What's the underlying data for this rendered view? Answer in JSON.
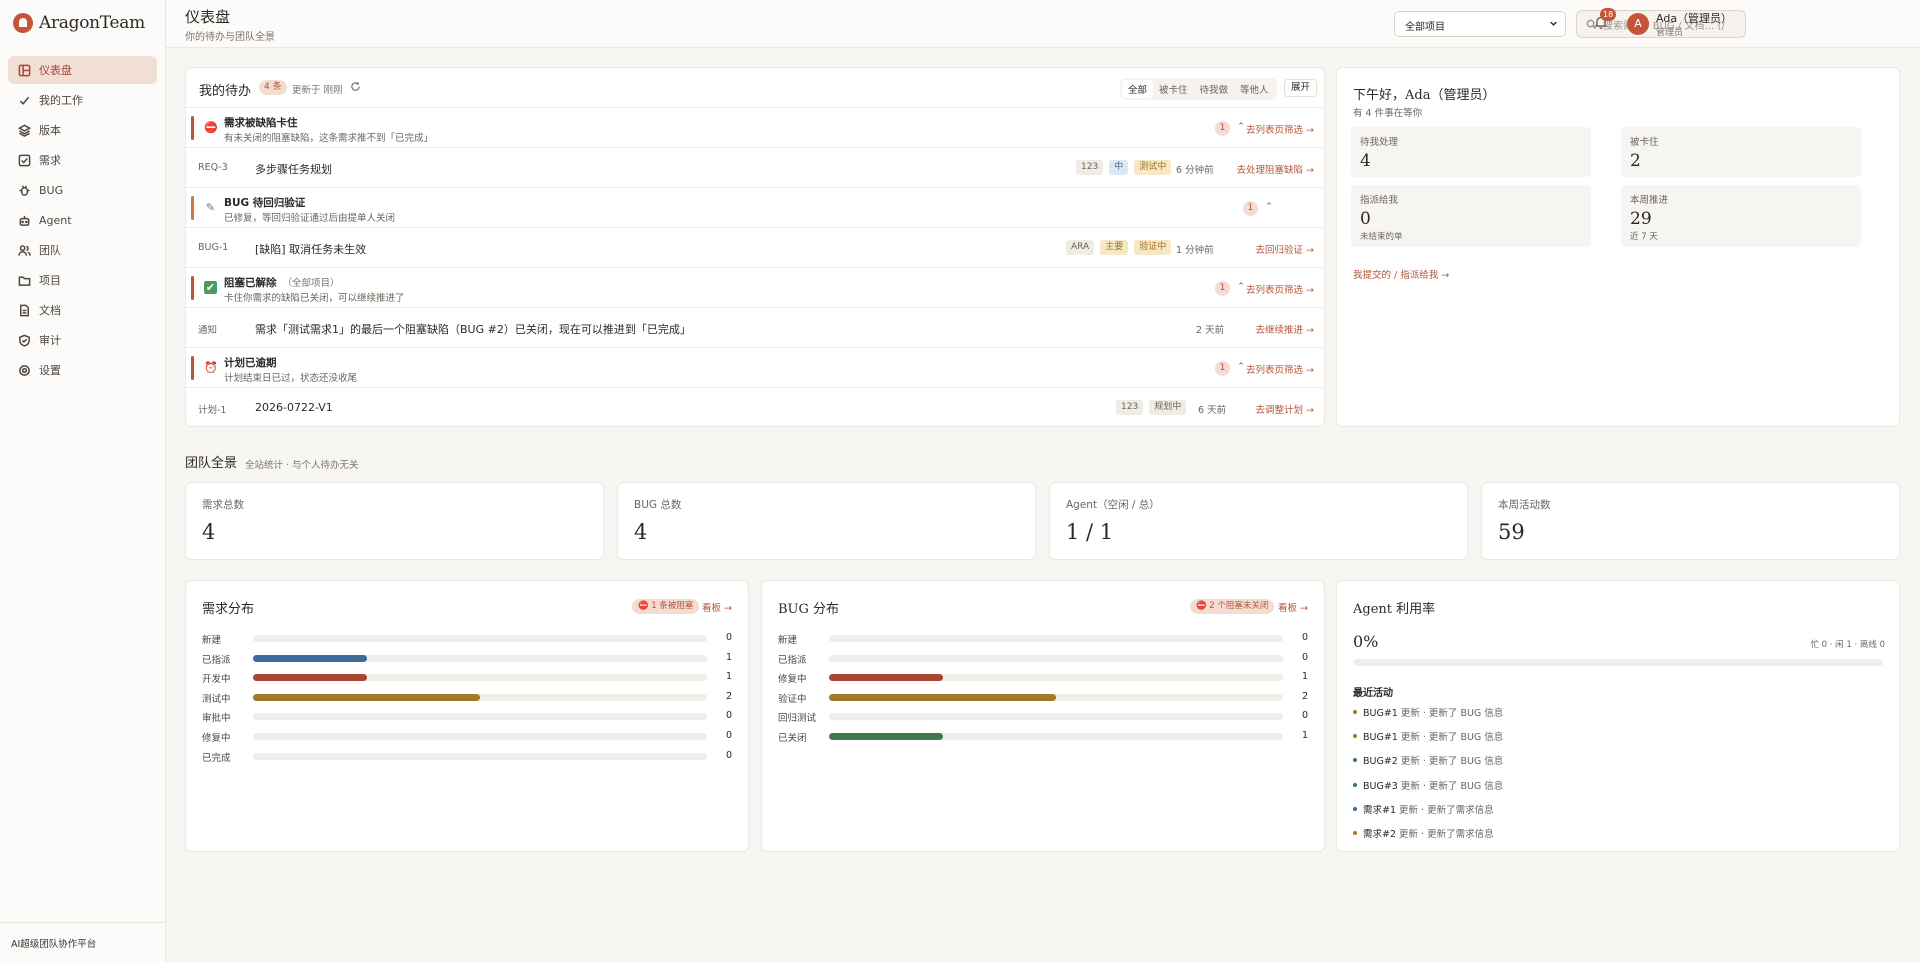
{
  "app": {
    "name": "AragonTeam",
    "footer": "AI超级团队协作平台"
  },
  "sidebar": {
    "items": [
      {
        "label": "仪表盘",
        "icon": "dashboard-icon",
        "active": true
      },
      {
        "label": "我的工作",
        "icon": "check-icon"
      },
      {
        "label": "版本",
        "icon": "layers-icon"
      },
      {
        "label": "需求",
        "icon": "checkbox-icon"
      },
      {
        "label": "BUG",
        "icon": "bug-icon"
      },
      {
        "label": "Agent",
        "icon": "robot-icon"
      },
      {
        "label": "团队",
        "icon": "users-icon"
      },
      {
        "label": "项目",
        "icon": "folder-icon"
      },
      {
        "label": "文档",
        "icon": "file-icon"
      },
      {
        "label": "审计",
        "icon": "shield-icon"
      },
      {
        "label": "设置",
        "icon": "gear-icon"
      }
    ]
  },
  "header": {
    "title": "仪表盘",
    "subtitle": "你的待办与团队全景",
    "project_select": "全部项目",
    "search_placeholder": "搜索需求 / BUG / 文档…  (/",
    "notifications": "18",
    "avatar_letter": "A",
    "user_name": "Ada（管理员）",
    "user_role": "管理员"
  },
  "todo": {
    "title": "我的待办",
    "count": "4 条",
    "updated": "更新于 刚刚",
    "filters": [
      "全部",
      "被卡住",
      "待我做",
      "等他人"
    ],
    "expand": "展开",
    "groups": [
      {
        "title": "需求被缺陷卡住",
        "scope": "",
        "sub": "有未关闭的阻塞缺陷，这条需求推不到「已完成」",
        "count": "1",
        "link": "去列表页筛选 →",
        "color": "#b5553a",
        "row": {
          "id": "REQ-3",
          "title": "多步骤任务规划",
          "tags": [
            "123",
            "中",
            "测试中"
          ],
          "time": "6 分钟前",
          "link": "去处理阻塞缺陷 →"
        }
      },
      {
        "title": "BUG 待回归验证",
        "scope": "",
        "sub": "已修复，等回归验证通过后由提单人关闭",
        "count": "1",
        "link": "",
        "color": "#c67a4a",
        "row": {
          "id": "BUG-1",
          "title": "[缺陷] 取消任务未生效",
          "tags": [
            "ARA",
            "主要",
            "验证中"
          ],
          "time": "1 分钟前",
          "link": "去回归验证 →"
        }
      },
      {
        "title": "阻塞已解除",
        "scope": "（全部项目）",
        "sub": "卡住你需求的缺陷已关闭，可以继续推进了",
        "count": "1",
        "link": "去列表页筛选 →",
        "color": "#b5553a",
        "row": {
          "id": "通知",
          "title": "需求「测试需求1」的最后一个阻塞缺陷（BUG #2）已关闭，现在可以推进到「已完成」",
          "tags": [],
          "time": "2 天前",
          "link": "去继续推进 →"
        }
      },
      {
        "title": "计划已逾期",
        "scope": "",
        "sub": "计划结束日已过，状态还没收尾",
        "count": "1",
        "link": "去列表页筛选 →",
        "color": "#b5553a",
        "row": {
          "id": "计划-1",
          "title": "2026-0722-V1",
          "tags": [
            "123",
            "规划中"
          ],
          "time": "6 天前",
          "link": "去调整计划 →"
        }
      }
    ]
  },
  "greeting": {
    "title": "下午好，Ada（管理员）",
    "sub": "有 4 件事在等你",
    "stats": [
      {
        "label": "待我处理",
        "value": "4",
        "sub": ""
      },
      {
        "label": "被卡住",
        "value": "2",
        "sub": ""
      },
      {
        "label": "指派给我",
        "value": "0",
        "sub": "未结束的单"
      },
      {
        "label": "本周推进",
        "value": "29",
        "sub": "近 7 天"
      }
    ],
    "link": "我提交的 / 指派给我 →"
  },
  "team": {
    "title": "团队全景",
    "sub": "全站统计 · 与个人待办无关"
  },
  "kpis": [
    {
      "label": "需求总数",
      "value": "4"
    },
    {
      "label": "BUG 总数",
      "value": "4"
    },
    {
      "label": "Agent（空闲 / 总）",
      "value": "1 / 1"
    },
    {
      "label": "本周活动数",
      "value": "59"
    }
  ],
  "req_dist": {
    "title": "需求分布",
    "pill": "⛔ 1 条被阻塞",
    "board": "看板 →",
    "max": 4,
    "rows": [
      {
        "label": "新建",
        "value": 0,
        "color": "#3f6a9c"
      },
      {
        "label": "已指派",
        "value": 1,
        "color": "#3f6a9c"
      },
      {
        "label": "开发中",
        "value": 1,
        "color": "#a8462f"
      },
      {
        "label": "测试中",
        "value": 2,
        "color": "#a07a25"
      },
      {
        "label": "审批中",
        "value": 0,
        "color": "#3f6a9c"
      },
      {
        "label": "修复中",
        "value": 0,
        "color": "#3f6a9c"
      },
      {
        "label": "已完成",
        "value": 0,
        "color": "#3f6a9c"
      }
    ]
  },
  "bug_dist": {
    "title": "BUG 分布",
    "pill": "⛔ 2 个阻塞未关闭",
    "board": "看板 →",
    "max": 4,
    "rows": [
      {
        "label": "新建",
        "value": 0,
        "color": "#3f6a9c"
      },
      {
        "label": "已指派",
        "value": 0,
        "color": "#3f6a9c"
      },
      {
        "label": "修复中",
        "value": 1,
        "color": "#a8462f"
      },
      {
        "label": "验证中",
        "value": 2,
        "color": "#a07a25"
      },
      {
        "label": "回归测试",
        "value": 0,
        "color": "#3f6a9c"
      },
      {
        "label": "已关闭",
        "value": 1,
        "color": "#3f7a4f"
      }
    ]
  },
  "agent": {
    "title": "Agent 利用率",
    "percent": "0%",
    "status": "忙 0 · 闲 1 · 离线 0",
    "recent_title": "最近活动",
    "activities": [
      {
        "who": "BUG#1",
        "text": " 更新 · 更新了 BUG 信息",
        "color": "#a07a25"
      },
      {
        "who": "BUG#1",
        "text": " 更新 · 更新了 BUG 信息",
        "color": "#a07a25"
      },
      {
        "who": "BUG#2",
        "text": " 更新 · 更新了 BUG 信息",
        "color": "#3f7a4f"
      },
      {
        "who": "BUG#3",
        "text": " 更新 · 更新了 BUG 信息",
        "color": "#3f7a4f"
      },
      {
        "who": "需求#1",
        "text": " 更新 · 更新了需求信息",
        "color": "#3f6a9c"
      },
      {
        "who": "需求#2",
        "text": " 更新 · 更新了需求信息",
        "color": "#a07a25"
      }
    ]
  }
}
